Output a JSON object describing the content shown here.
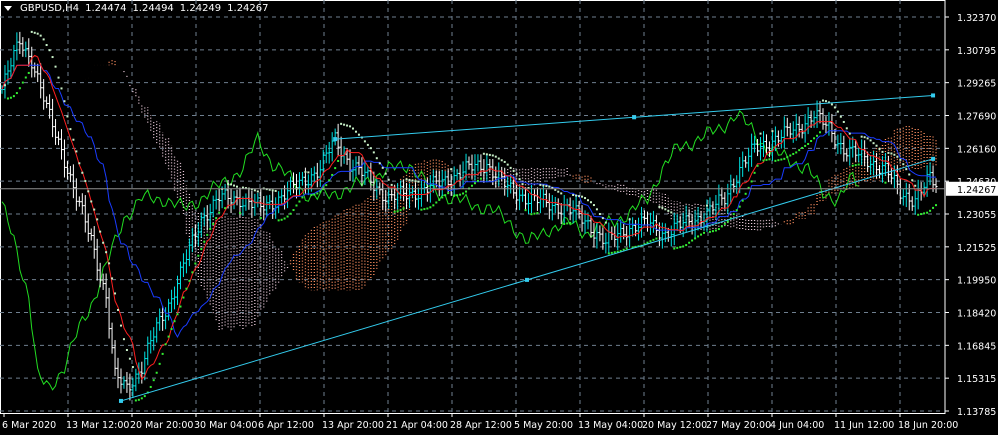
{
  "header": {
    "symbol": "GBPUSD,H4",
    "open": "1.24474",
    "high": "1.24494",
    "low": "1.24249",
    "close": "1.24267"
  },
  "colors": {
    "bg": "#000000",
    "grid": "#6f7f8f",
    "bull": "#00e5e5",
    "bear": "#ffffff",
    "tenkan": "#ff2020",
    "kijun": "#1a3cff",
    "chikou": "#22dd22",
    "sar": "#33ee33",
    "cloud_up": "#ff9060",
    "cloud_down": "#e8c8d8",
    "trend": "#33ccee"
  },
  "chart_data": {
    "type": "candlestick",
    "symbol": "GBPUSD",
    "timeframe": "H4",
    "ylim": [
      1.13785,
      1.3237
    ],
    "y_ticks": [
      "1.32370",
      "1.30795",
      "1.29265",
      "1.27690",
      "1.26160",
      "1.24630",
      "1.23055",
      "1.21525",
      "1.19950",
      "1.18420",
      "1.16845",
      "1.15315",
      "1.13785"
    ],
    "x_ticks": [
      "6 Mar 2020",
      "13 Mar 12:00",
      "20 Mar 20:00",
      "30 Mar 04:00",
      "6 Apr 12:00",
      "13 Apr 20:00",
      "21 Apr 04:00",
      "28 Apr 12:00",
      "5 May 20:00",
      "13 May 04:00",
      "20 May 12:00",
      "27 May 20:00",
      "4 Jun 04:00",
      "11 Jun 12:00",
      "18 Jun 20:00"
    ],
    "bars_total": 315,
    "current_price": "1.24267",
    "close_path": [
      [
        0,
        1.2895
      ],
      [
        6,
        1.3129
      ],
      [
        10,
        1.3036
      ],
      [
        15,
        1.2802
      ],
      [
        20,
        1.2615
      ],
      [
        25,
        1.2381
      ],
      [
        30,
        1.2193
      ],
      [
        35,
        1.1913
      ],
      [
        38,
        1.1538
      ],
      [
        42,
        1.1491
      ],
      [
        47,
        1.1585
      ],
      [
        52,
        1.1772
      ],
      [
        57,
        1.1913
      ],
      [
        62,
        1.21
      ],
      [
        67,
        1.2287
      ],
      [
        73,
        1.2381
      ],
      [
        80,
        1.2381
      ],
      [
        87,
        1.2334
      ],
      [
        93,
        1.2381
      ],
      [
        100,
        1.2451
      ],
      [
        107,
        1.2521
      ],
      [
        112,
        1.2661
      ],
      [
        117,
        1.2544
      ],
      [
        123,
        1.2474
      ],
      [
        130,
        1.2381
      ],
      [
        137,
        1.2404
      ],
      [
        143,
        1.2427
      ],
      [
        150,
        1.2474
      ],
      [
        157,
        1.2521
      ],
      [
        163,
        1.2544
      ],
      [
        170,
        1.2427
      ],
      [
        177,
        1.2381
      ],
      [
        183,
        1.2357
      ],
      [
        190,
        1.2334
      ],
      [
        197,
        1.2264
      ],
      [
        203,
        1.217
      ],
      [
        210,
        1.224
      ],
      [
        217,
        1.2264
      ],
      [
        223,
        1.2217
      ],
      [
        230,
        1.2264
      ],
      [
        237,
        1.231
      ],
      [
        243,
        1.2381
      ],
      [
        248,
        1.2521
      ],
      [
        253,
        1.2615
      ],
      [
        260,
        1.2661
      ],
      [
        267,
        1.2708
      ],
      [
        273,
        1.2778
      ],
      [
        278,
        1.2708
      ],
      [
        283,
        1.2615
      ],
      [
        290,
        1.2568
      ],
      [
        297,
        1.2521
      ],
      [
        302,
        1.2404
      ],
      [
        307,
        1.2381
      ],
      [
        312,
        1.2474
      ],
      [
        315,
        1.2427
      ]
    ],
    "trendlines": [
      {
        "name": "upper",
        "from": [
          112,
          1.2661
        ],
        "to": [
          313,
          1.2867
        ]
      },
      {
        "name": "lower",
        "from": [
          40,
          1.1426
        ],
        "to": [
          313,
          1.2568
        ]
      }
    ]
  }
}
